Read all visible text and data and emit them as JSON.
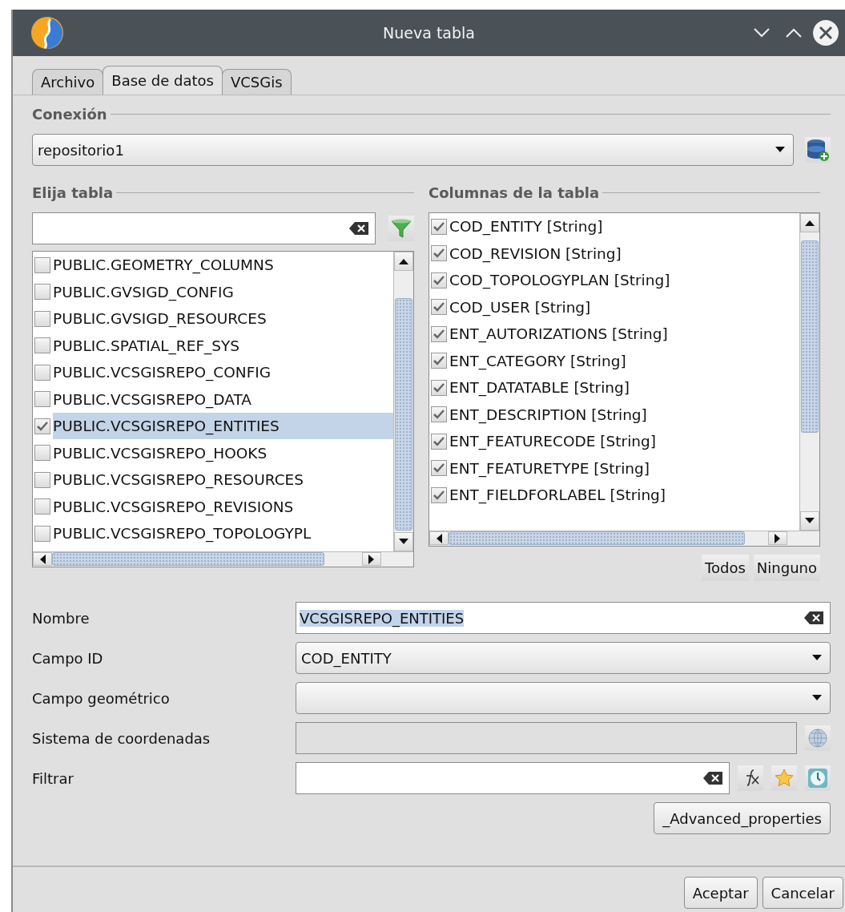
{
  "window": {
    "title": "Nueva tabla"
  },
  "tabs": [
    {
      "label": "Archivo",
      "selected": false
    },
    {
      "label": "Base de datos",
      "selected": true
    },
    {
      "label": "VCSGis",
      "selected": false
    }
  ],
  "connection": {
    "heading": "Conexión",
    "value": "repositorio1"
  },
  "tables": {
    "heading": "Elija tabla",
    "items": [
      {
        "label": "PUBLIC.GEOMETRY_COLUMNS",
        "checked": false,
        "selected": false
      },
      {
        "label": "PUBLIC.GVSIGD_CONFIG",
        "checked": false,
        "selected": false
      },
      {
        "label": "PUBLIC.GVSIGD_RESOURCES",
        "checked": false,
        "selected": false
      },
      {
        "label": "PUBLIC.SPATIAL_REF_SYS",
        "checked": false,
        "selected": false
      },
      {
        "label": "PUBLIC.VCSGISREPO_CONFIG",
        "checked": false,
        "selected": false
      },
      {
        "label": "PUBLIC.VCSGISREPO_DATA",
        "checked": false,
        "selected": false
      },
      {
        "label": "PUBLIC.VCSGISREPO_ENTITIES",
        "checked": true,
        "selected": true
      },
      {
        "label": "PUBLIC.VCSGISREPO_HOOKS",
        "checked": false,
        "selected": false
      },
      {
        "label": "PUBLIC.VCSGISREPO_RESOURCES",
        "checked": false,
        "selected": false
      },
      {
        "label": "PUBLIC.VCSGISREPO_REVISIONS",
        "checked": false,
        "selected": false
      },
      {
        "label": "PUBLIC.VCSGISREPO_TOPOLOGYPL",
        "checked": false,
        "selected": false
      }
    ]
  },
  "columns": {
    "heading": "Columnas de la tabla",
    "items": [
      {
        "label": "COD_ENTITY [String]",
        "checked": true
      },
      {
        "label": "COD_REVISION [String]",
        "checked": true
      },
      {
        "label": "COD_TOPOLOGYPLAN [String]",
        "checked": true
      },
      {
        "label": "COD_USER [String]",
        "checked": true
      },
      {
        "label": "ENT_AUTORIZATIONS [String]",
        "checked": true
      },
      {
        "label": "ENT_CATEGORY [String]",
        "checked": true
      },
      {
        "label": "ENT_DATATABLE [String]",
        "checked": true
      },
      {
        "label": "ENT_DESCRIPTION [String]",
        "checked": true
      },
      {
        "label": "ENT_FEATURECODE [String]",
        "checked": true
      },
      {
        "label": "ENT_FEATURETYPE [String]",
        "checked": true
      },
      {
        "label": "ENT_FIELDFORLABEL [String]",
        "checked": true
      }
    ],
    "buttons": [
      "Todos",
      "Ninguno"
    ]
  },
  "form": [
    {
      "kind": "text",
      "label": "Nombre",
      "value": "VCSGISREPO_ENTITIES",
      "value_selected": true
    },
    {
      "kind": "combo",
      "label": "Campo ID",
      "value": "COD_ENTITY"
    },
    {
      "kind": "combo",
      "label": "Campo geométrico"
    },
    {
      "kind": "crs",
      "label": "Sistema de coordenadas"
    },
    {
      "kind": "filter",
      "label": "Filtrar"
    }
  ],
  "advanced_button": "_Advanced_properties",
  "footer_buttons": [
    "Aceptar",
    "Cancelar"
  ]
}
